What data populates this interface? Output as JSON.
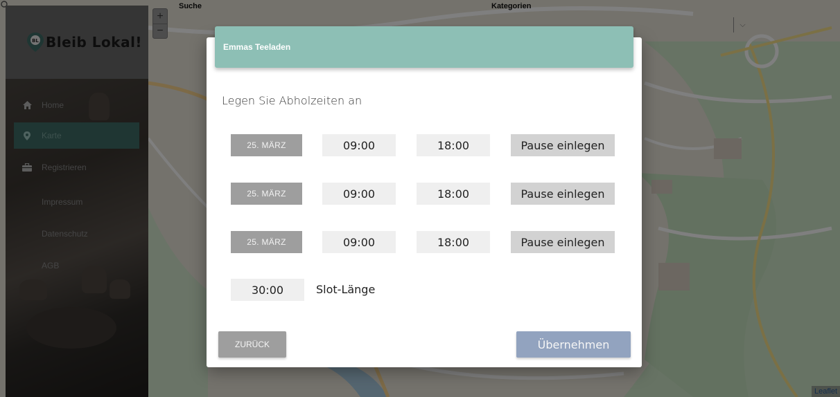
{
  "app": {
    "logo_text": "Bleib Lokal!",
    "logo_badge": "BL",
    "accent_color": "#3f6d66",
    "header_color": "#8dbfb5"
  },
  "sidebar": {
    "items": [
      {
        "label": "Home",
        "icon": "home-icon"
      },
      {
        "label": "Karte",
        "icon": "map-pin-icon",
        "active": true
      },
      {
        "label": "Registrieren",
        "icon": "briefcase-icon"
      },
      {
        "label": "Impressum"
      },
      {
        "label": "Datenschutz"
      },
      {
        "label": "AGB"
      }
    ]
  },
  "map": {
    "search_label": "Suche",
    "categories_label": "Kategorien",
    "attribution": "Leaflet",
    "zoom_in": "+",
    "zoom_out": "−"
  },
  "modal": {
    "title": "Emmas Teeladen",
    "subtitle": "Legen Sie Abholzeiten an",
    "rows": [
      {
        "date": "25. MÄRZ",
        "start": "09:00",
        "end": "18:00",
        "pause_label": "Pause einlegen"
      },
      {
        "date": "25. MÄRZ",
        "start": "09:00",
        "end": "18:00",
        "pause_label": "Pause einlegen"
      },
      {
        "date": "25. MÄRZ",
        "start": "09:00",
        "end": "18:00",
        "pause_label": "Pause einlegen"
      }
    ],
    "slot_value": "30:00",
    "slot_label": "Slot-Länge",
    "back_label": "ZURÜCK",
    "apply_label": "Übernehmen"
  }
}
